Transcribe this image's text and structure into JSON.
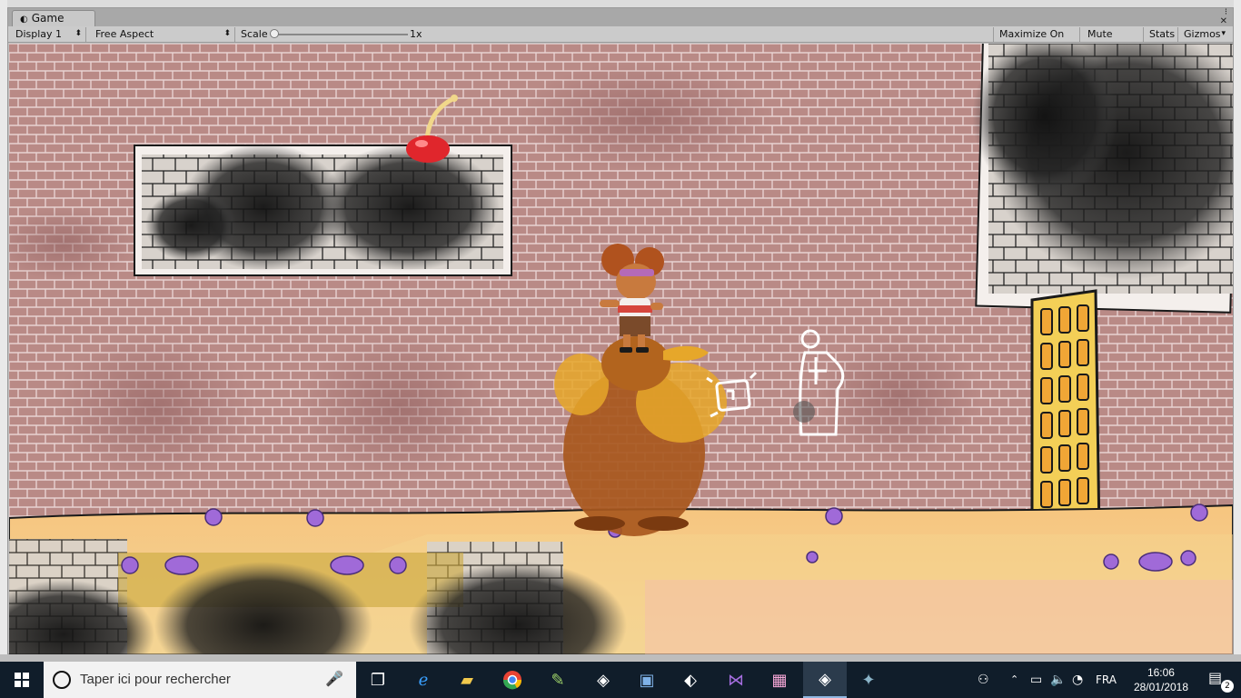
{
  "window": {
    "tab_title": "Game",
    "tab_icon": "unity-logo-icon",
    "controls": [
      "⁝",
      "✕"
    ]
  },
  "toolbar": {
    "display": "Display 1",
    "aspect": "Free Aspect",
    "scale_label": "Scale",
    "scale_value": "1x",
    "maximize_on_play": "Maximize On Play",
    "mute_audio": "Mute Audio",
    "stats": "Stats",
    "gizmos": "Gizmos"
  },
  "taskbar": {
    "search_placeholder": "Taper ici pour rechercher",
    "apps": [
      "task-view-icon",
      "edge-icon",
      "file-explorer-icon",
      "chrome-icon",
      "notepad-icon",
      "unity-icon",
      "app-window-icon",
      "inkscape-icon",
      "visual-studio-icon",
      "paint-icon",
      "unity-icon",
      "turtle-icon"
    ],
    "language": "FRA",
    "time": "16:06",
    "date": "28/01/2018",
    "notification_count": "2"
  },
  "colors": {
    "brick_wall": "#b98a86",
    "floor": "#f2c98a",
    "ink_dark": "#1e1a1a",
    "door_gold": "#f3cf57",
    "taskbar": "#101d2a"
  }
}
